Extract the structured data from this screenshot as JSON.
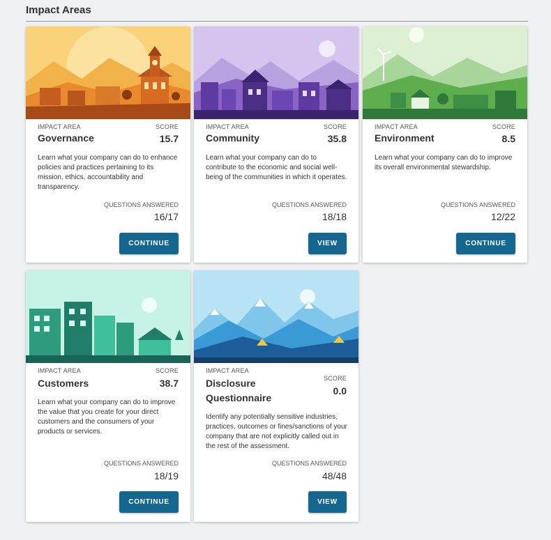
{
  "page": {
    "title": "Impact Areas"
  },
  "labels": {
    "impact_area": "IMPACT AREA",
    "score": "SCORE",
    "questions_answered": "QUESTIONS ANSWERED"
  },
  "cards": [
    {
      "name": "Governance",
      "score": "15.7",
      "description": "Learn what your company can do to enhance policies and practices pertaining to its mission, ethics, accountability and transparency.",
      "questions": "16/17",
      "button": "CONTINUE",
      "illustration": "town-hall-illustration",
      "colors": {
        "sky": "#f9d27a",
        "accent": "#e8892c",
        "dark": "#b8561f"
      }
    },
    {
      "name": "Community",
      "score": "35.8",
      "description": "Learn what your company can do to contribute to the economic and social well-being of the communities in which it operates.",
      "questions": "18/18",
      "button": "VIEW",
      "illustration": "village-illustration",
      "colors": {
        "sky": "#c8b6e6",
        "accent": "#8a64c4",
        "dark": "#4b2f86"
      }
    },
    {
      "name": "Environment",
      "score": "8.5",
      "description": "Learn what your company can do to improve its overall environmental stewardship.",
      "questions": "12/22",
      "button": "CONTINUE",
      "illustration": "green-hills-illustration",
      "colors": {
        "sky": "#cfe9c1",
        "accent": "#5eae4e",
        "dark": "#2f7a3a"
      }
    },
    {
      "name": "Customers",
      "score": "38.7",
      "description": "Learn what your company can do to improve the value that you create for your direct customers and the consumers of your products or services.",
      "questions": "18/19",
      "button": "CONTINUE",
      "illustration": "city-street-illustration",
      "colors": {
        "sky": "#bff0e2",
        "accent": "#3fbf9a",
        "dark": "#1f7d68"
      }
    },
    {
      "name": "Disclosure Questionnaire",
      "score": "0.0",
      "description": "Identify any potentially sensitive industries, practices, outcomes or fines/sanctions of your company that are not explicitly called out in the rest of the assessment.",
      "questions": "48/48",
      "button": "VIEW",
      "illustration": "mountains-illustration",
      "colors": {
        "sky": "#a9dcf2",
        "accent": "#3a9ad6",
        "dark": "#1d5e9a"
      }
    }
  ]
}
